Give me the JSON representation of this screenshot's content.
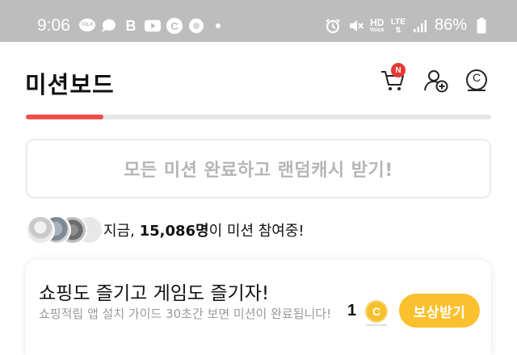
{
  "status_bar": {
    "time": "9:06",
    "battery": "86%",
    "talk_icon_text": "TALK",
    "b_icon_text": "B",
    "c_icon_text": "C",
    "hd_text": "HD",
    "voice_text": "Voice",
    "lte_text": "LTE",
    "left_icons": [
      "talk-icon",
      "chat-bubble-icon",
      "b-app-icon",
      "youtube-icon",
      "c-app-icon",
      "app-icon",
      "dot-icon"
    ],
    "right_icons": [
      "alarm-icon",
      "mute-icon",
      "hd-voice-icon",
      "lte-icon",
      "signal-icon",
      "battery-icon"
    ]
  },
  "header": {
    "title": "미션보드",
    "cart_badge": "N",
    "coin_symbol": "C",
    "icons": [
      "cart-icon",
      "add-user-icon",
      "coin-history-icon"
    ]
  },
  "progress": {
    "value": 0.167
  },
  "complete_banner": {
    "label": "모든 미션 완료하고 랜덤캐시 받기!"
  },
  "participants": {
    "prefix": "지금, ",
    "count": "15,086명",
    "suffix": "이 미션 참여중!"
  },
  "mission": {
    "title": "쇼핑도 즐기고 게임도 즐기자!",
    "description": "쇼핑적립 앱 설치 가이드 30초간 보면 미션이 완료됩니다!",
    "reward_count": "1",
    "coin_symbol": "C",
    "reward_button": "보상받기"
  },
  "colors": {
    "status_bar": "#bdbdbd",
    "progress": "#ef4e4e",
    "reward_button": "#fbc02d",
    "badge": "#e53935"
  }
}
